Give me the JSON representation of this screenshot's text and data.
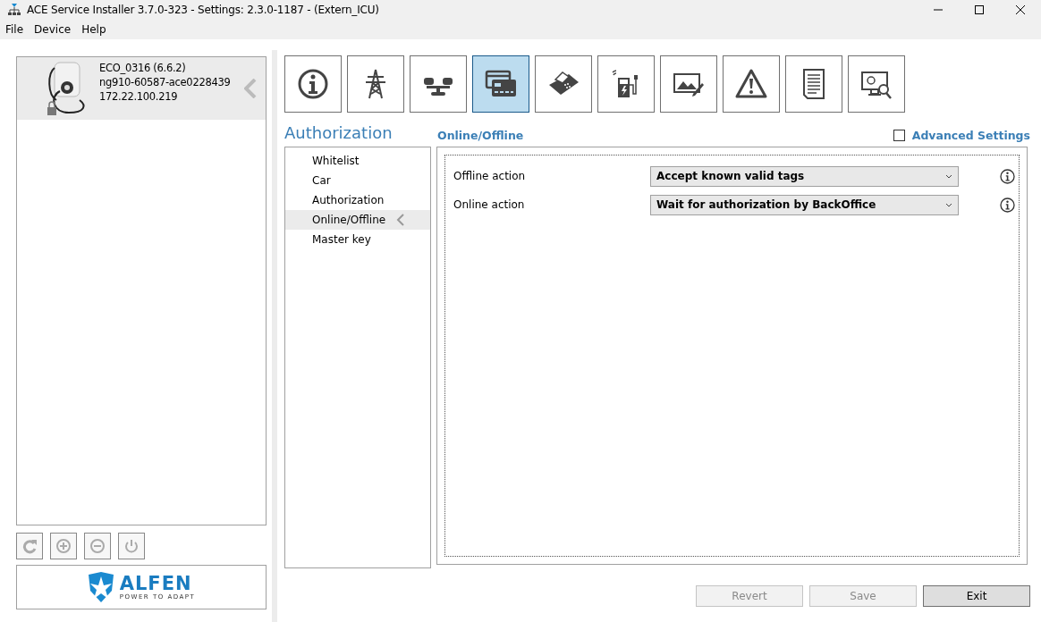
{
  "window": {
    "title": "ACE Service Installer 3.7.0-323 - Settings: 2.3.0-1187 -  (Extern_ICU)"
  },
  "menu": [
    "File",
    "Device",
    "Help"
  ],
  "device": {
    "name": "ECO_0316 (6.6.2)",
    "serial": "ng910-60587-ace0228439",
    "ip": "172.22.100.219",
    "locked": true,
    "selected": true
  },
  "device_tools": [
    {
      "kind": "refresh",
      "disabled": true
    },
    {
      "kind": "add",
      "disabled": true
    },
    {
      "kind": "remove",
      "disabled": true
    },
    {
      "kind": "power",
      "disabled": true
    }
  ],
  "logo": {
    "name": "ALFEN",
    "tagline": "POWER TO ADAPT"
  },
  "categories": [
    {
      "kind": "info",
      "selected": false
    },
    {
      "kind": "tower",
      "selected": false
    },
    {
      "kind": "scale",
      "selected": false
    },
    {
      "kind": "cards",
      "selected": true
    },
    {
      "kind": "terminal",
      "selected": false
    },
    {
      "kind": "charger",
      "selected": false
    },
    {
      "kind": "picture",
      "selected": false
    },
    {
      "kind": "warning",
      "selected": false
    },
    {
      "kind": "document",
      "selected": false
    },
    {
      "kind": "monitor",
      "selected": false
    }
  ],
  "section_title": "Authorization",
  "subnav": [
    {
      "label": "Whitelist",
      "selected": false
    },
    {
      "label": "Car",
      "selected": false
    },
    {
      "label": "Authorization",
      "selected": false
    },
    {
      "label": "Online/Offline",
      "selected": true
    },
    {
      "label": "Master key",
      "selected": false
    }
  ],
  "page_title": "Online/Offline",
  "advanced_settings": {
    "label": "Advanced Settings",
    "checked": false
  },
  "settings": [
    {
      "label": "Offline action",
      "value": "Accept known valid tags"
    },
    {
      "label": "Online action",
      "value": "Wait for authorization by BackOffice"
    }
  ],
  "buttons": [
    {
      "label": "Revert",
      "disabled": true
    },
    {
      "label": "Save",
      "disabled": true
    },
    {
      "label": "Exit",
      "disabled": false
    }
  ]
}
